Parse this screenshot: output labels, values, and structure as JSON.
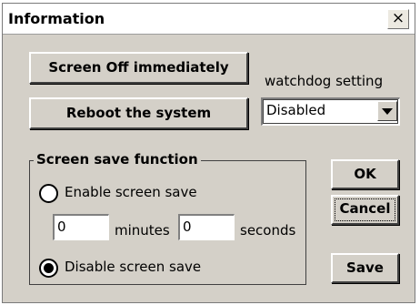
{
  "window": {
    "title": "Information",
    "close_glyph": "×"
  },
  "buttons": {
    "screen_off": "Screen Off immediately",
    "reboot": "Reboot the system",
    "ok": "OK",
    "cancel": "Cancel",
    "save": "Save"
  },
  "watchdog": {
    "label": "watchdog setting",
    "selected": "Disabled"
  },
  "screen_save": {
    "group_title": "Screen save function",
    "enable_label": "Enable screen save",
    "disable_label": "Disable screen save",
    "minutes_value": "0",
    "minutes_label": "minutes",
    "seconds_value": "0",
    "seconds_label": "seconds",
    "selected_option": "disable"
  }
}
